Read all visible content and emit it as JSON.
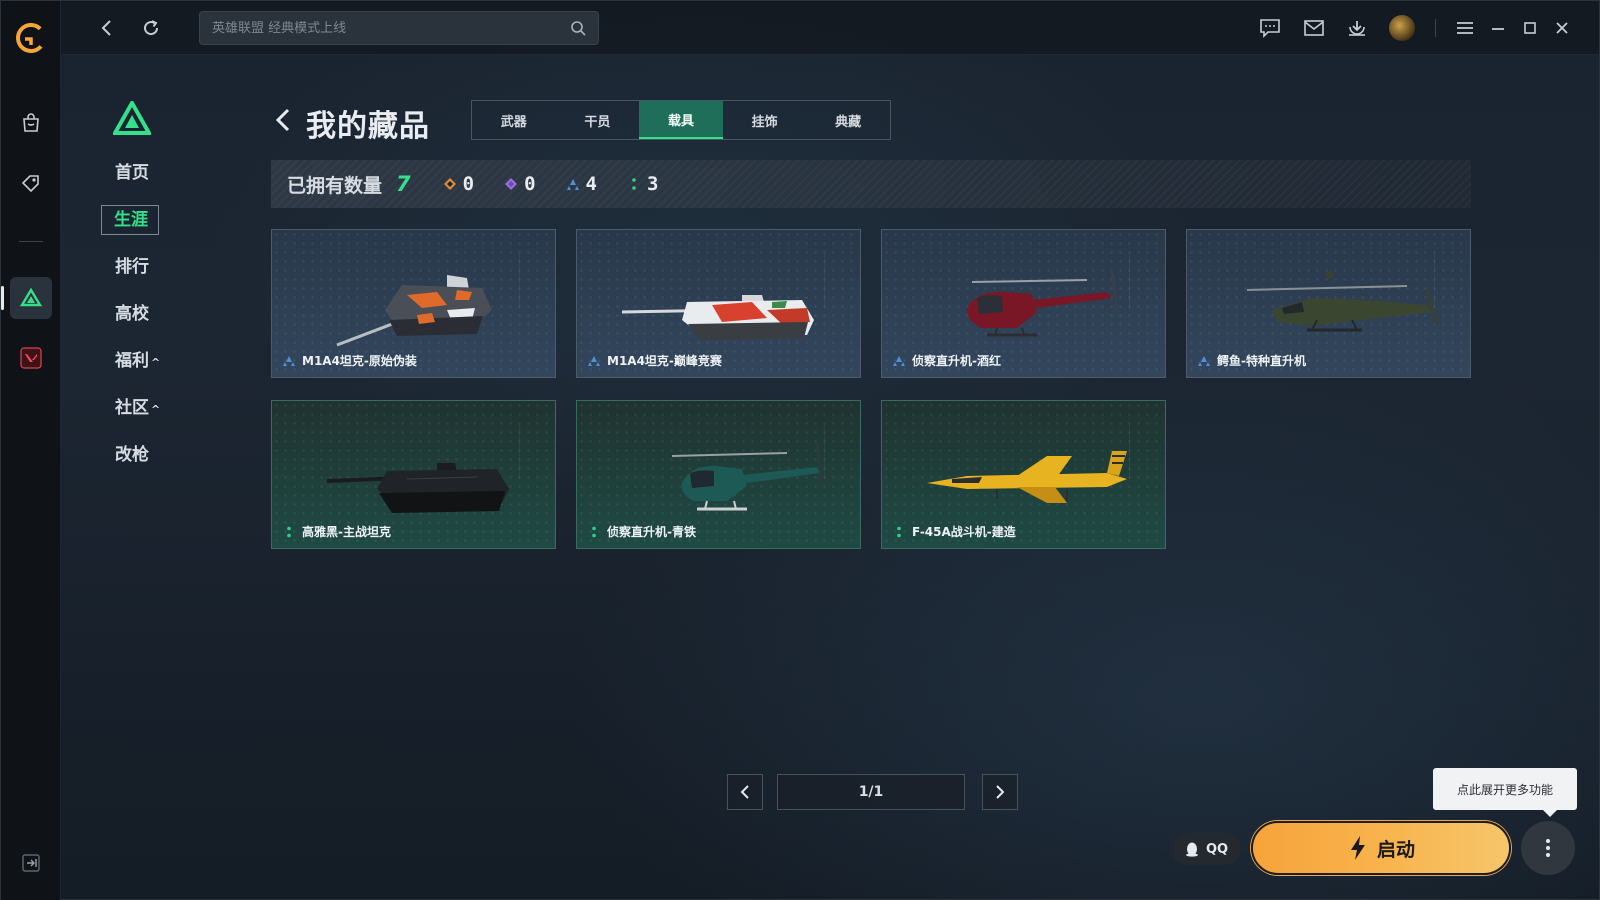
{
  "search": {
    "placeholder": "英雄联盟 经典模式上线"
  },
  "topbar_icons": [
    "back-icon",
    "refresh-icon",
    "chat-icon",
    "mail-icon",
    "download-icon",
    "menu-icon",
    "minimize-icon",
    "maximize-icon",
    "close-icon"
  ],
  "leftnav": {
    "items": [
      {
        "label": "首页",
        "caret": ""
      },
      {
        "label": "生涯",
        "caret": ""
      },
      {
        "label": "排行",
        "caret": ""
      },
      {
        "label": "高校",
        "caret": ""
      },
      {
        "label": "福利",
        "caret": "^"
      },
      {
        "label": "社区",
        "caret": "^"
      },
      {
        "label": "改枪",
        "caret": ""
      }
    ]
  },
  "page": {
    "title": "我的藏品"
  },
  "tabs": [
    "武器",
    "干员",
    "载具",
    "挂饰",
    "典藏"
  ],
  "active_tab": "载具",
  "owned": {
    "label": "已拥有数量",
    "total": "7",
    "counts": [
      {
        "rarity": "orange",
        "value": "0"
      },
      {
        "rarity": "purple",
        "value": "0"
      },
      {
        "rarity": "blue",
        "value": "4"
      },
      {
        "rarity": "green",
        "value": "3"
      }
    ]
  },
  "items": [
    {
      "name": "M1A4坦克-原始伪装",
      "rarity": "blue",
      "kind": "tank-camo"
    },
    {
      "name": "M1A4坦克-巅峰竞赛",
      "rarity": "blue",
      "kind": "tank-race"
    },
    {
      "name": "侦察直升机-酒红",
      "rarity": "blue",
      "kind": "heli-red"
    },
    {
      "name": "鳄鱼-特种直升机",
      "rarity": "blue",
      "kind": "heli-apache"
    },
    {
      "name": "高雅黑-主战坦克",
      "rarity": "green",
      "kind": "tank-black"
    },
    {
      "name": "侦察直升机-青铁",
      "rarity": "green",
      "kind": "heli-teal"
    },
    {
      "name": "F-45A战斗机-建造",
      "rarity": "green",
      "kind": "jet-yellow"
    }
  ],
  "pager": {
    "label": "1/1"
  },
  "tooltip": "点此展开更多功能",
  "qq_label": "QQ",
  "launch_label": "启动",
  "colors": {
    "accent_green": "#35e08a",
    "launch_orange": "#f8b34d",
    "rarity_blue": "#4f8fd8",
    "rarity_green": "#2fd18a",
    "rarity_orange": "#e08a3a",
    "rarity_purple": "#9b6ee0"
  }
}
